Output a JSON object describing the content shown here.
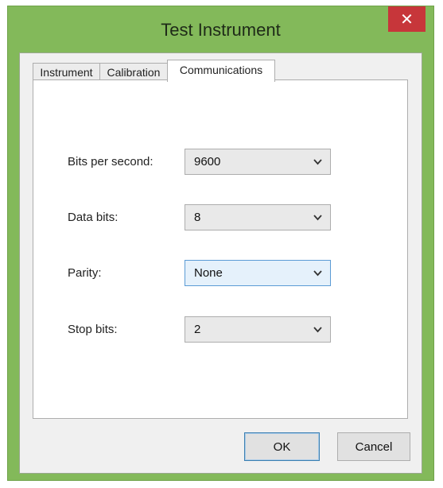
{
  "window": {
    "title": "Test Instrument",
    "close_glyph": "✕",
    "frame_color": "#83b95a",
    "close_color": "#c7363a"
  },
  "tabs": [
    {
      "label": "Instrument",
      "active": false
    },
    {
      "label": "Calibration",
      "active": false
    },
    {
      "label": "Communications",
      "active": true
    }
  ],
  "fields": {
    "bits_per_second": {
      "label": "Bits per second:",
      "value": "9600"
    },
    "data_bits": {
      "label": "Data bits:",
      "value": "8"
    },
    "parity": {
      "label": "Parity:",
      "value": "None"
    },
    "stop_bits": {
      "label": "Stop bits:",
      "value": "2"
    }
  },
  "buttons": {
    "ok": "OK",
    "cancel": "Cancel"
  },
  "icons": {
    "close": "close-icon",
    "dropdown": "chevron-down-icon"
  }
}
